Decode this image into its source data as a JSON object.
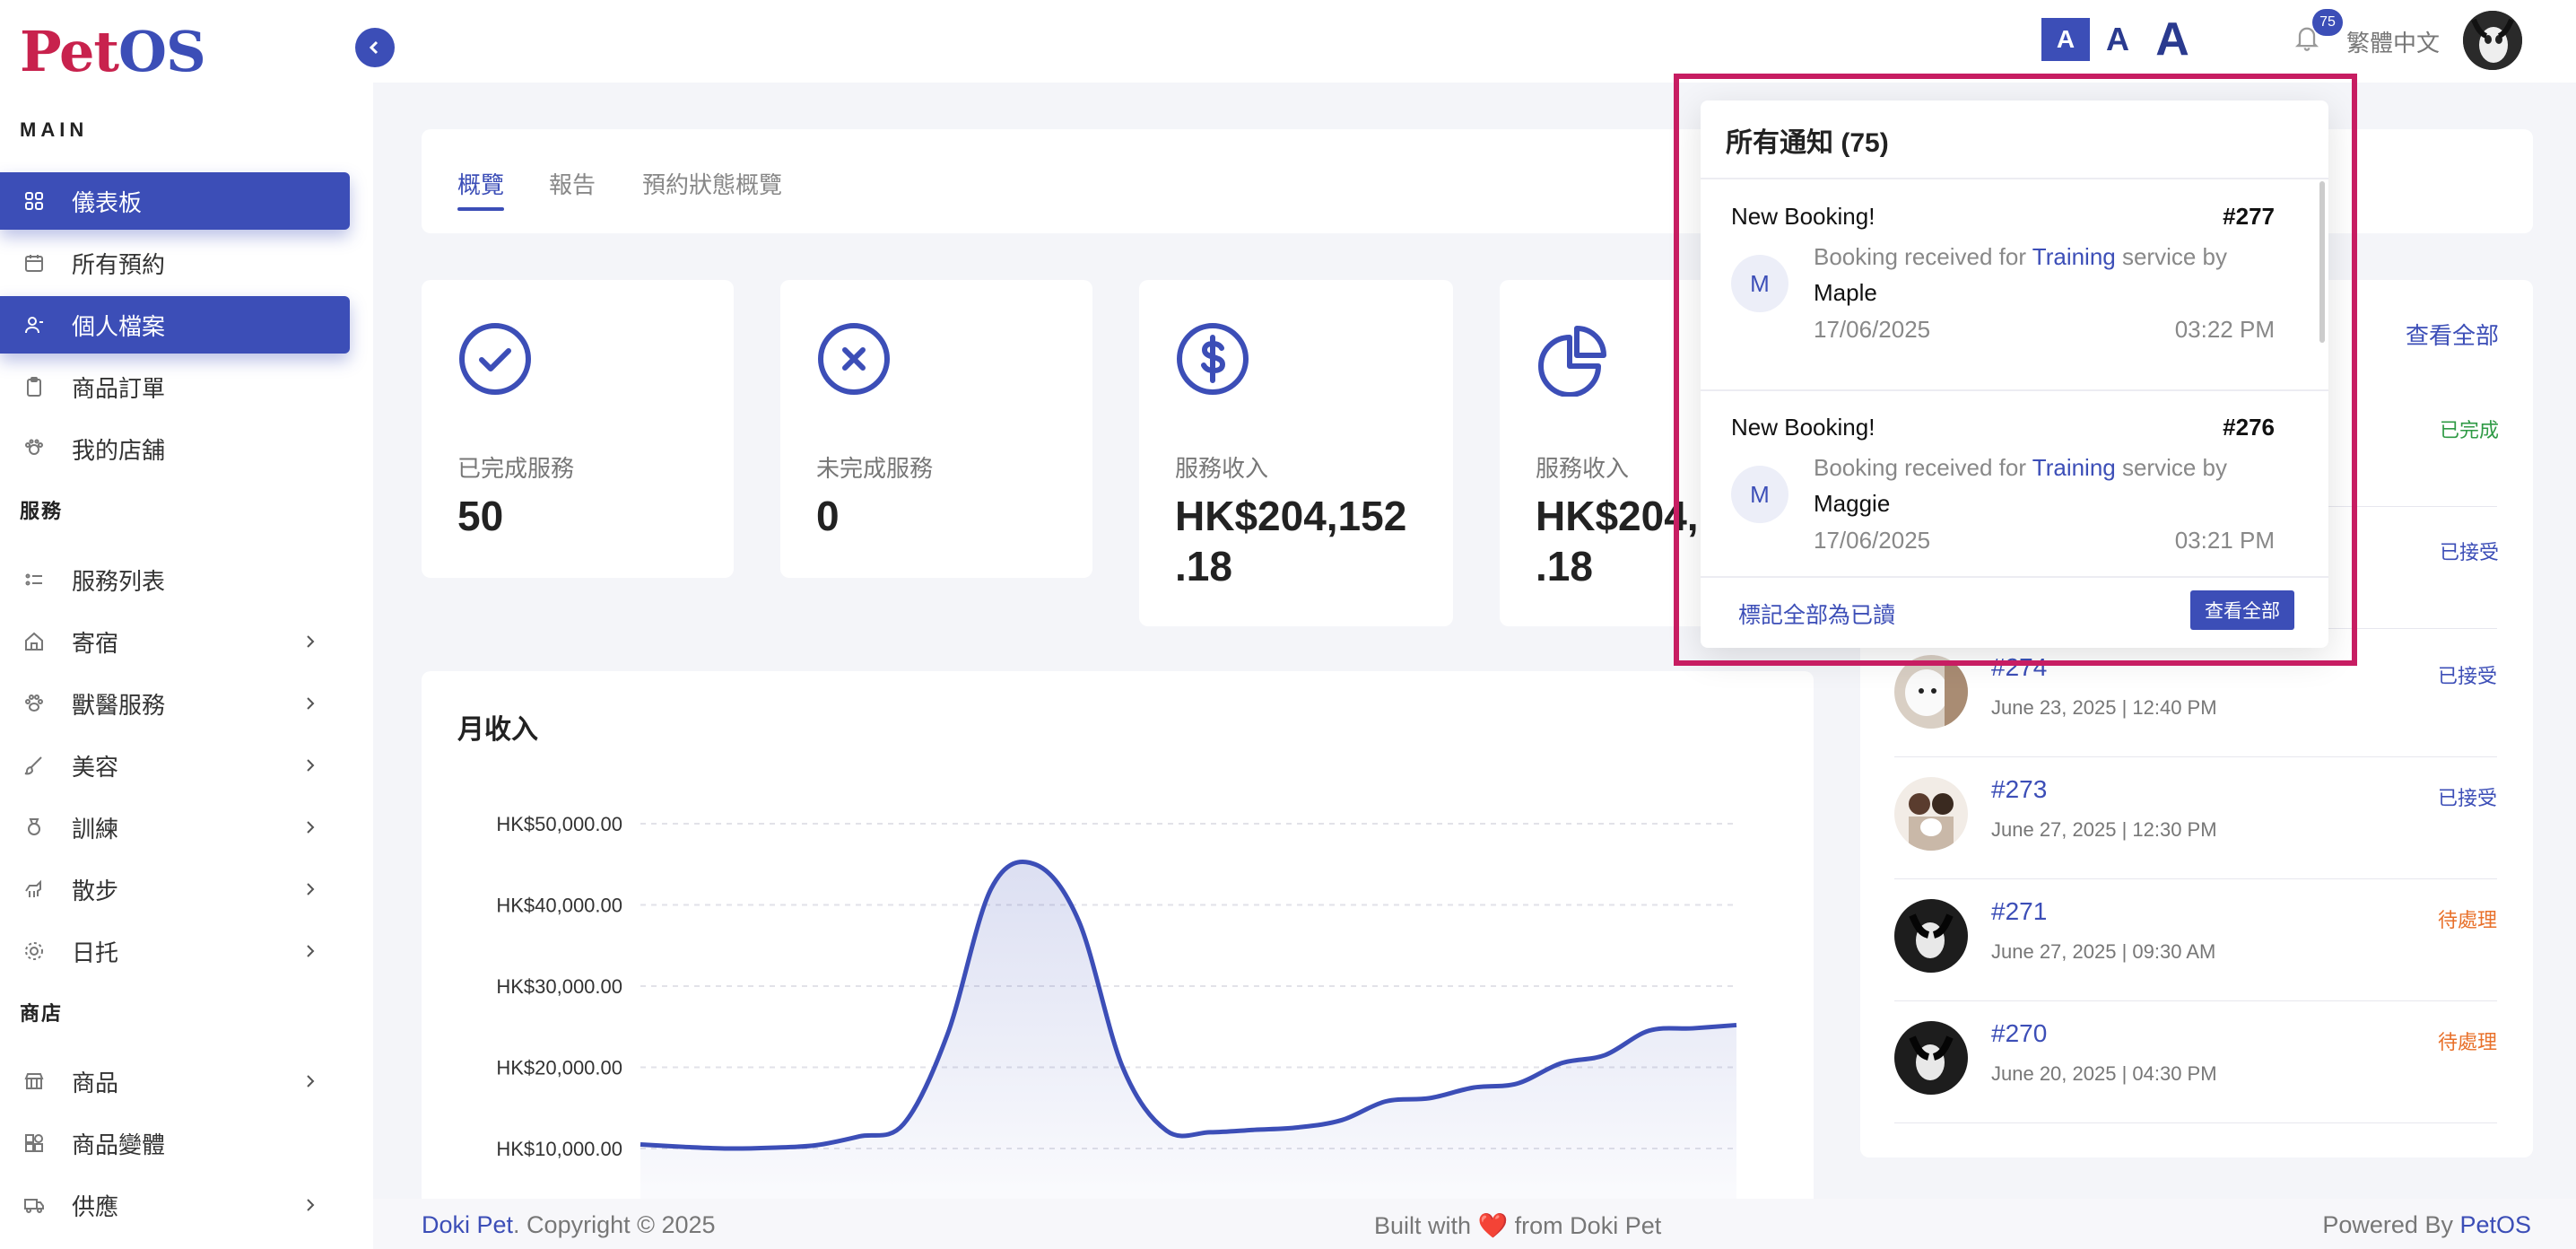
{
  "brand": {
    "logo_pet": "Pet",
    "logo_os": "OS"
  },
  "sidebar": {
    "sections": {
      "main": "MAIN",
      "services": "服務",
      "shop": "商店"
    },
    "items": [
      {
        "label": "儀表板",
        "icon": "dashboard-grid-icon"
      },
      {
        "label": "所有預約",
        "icon": "calendar-icon"
      },
      {
        "label": "個人檔案",
        "icon": "user-icon"
      },
      {
        "label": "商品訂單",
        "icon": "clipboard-icon"
      },
      {
        "label": "我的店舖",
        "icon": "store-icon"
      },
      {
        "label": "服務列表",
        "icon": "list-icon"
      },
      {
        "label": "寄宿",
        "icon": "home-icon"
      },
      {
        "label": "獸醫服務",
        "icon": "paw-icon"
      },
      {
        "label": "美容",
        "icon": "brush-icon"
      },
      {
        "label": "訓練",
        "icon": "medal-icon"
      },
      {
        "label": "散步",
        "icon": "dog-walk-icon"
      },
      {
        "label": "日托",
        "icon": "daycare-icon"
      },
      {
        "label": "商品",
        "icon": "shop-icon"
      },
      {
        "label": "商品變體",
        "icon": "variant-icon"
      },
      {
        "label": "供應",
        "icon": "truck-icon"
      }
    ]
  },
  "topbar": {
    "font_sizes": [
      "A",
      "A",
      "A"
    ],
    "notification_count": "75",
    "language": "繁體中文"
  },
  "tabs": [
    "概覽",
    "報告",
    "預約狀態概覽"
  ],
  "stats": [
    {
      "label": "已完成服務",
      "value": "50",
      "icon": "check-circle-icon"
    },
    {
      "label": "未完成服務",
      "value": "0",
      "icon": "x-circle-icon"
    },
    {
      "label": "服務收入",
      "value_line1": "HK$204,152",
      "value_line2": ".18",
      "icon": "dollar-circle-icon"
    },
    {
      "label": "服務收入",
      "value_line1": "HK$204,",
      "value_line2": ".18",
      "icon": "pie-chart-icon"
    }
  ],
  "chart_data": {
    "type": "area",
    "title": "月收入",
    "y_ticks": [
      "HK$50,000.00",
      "HK$40,000.00",
      "HK$30,000.00",
      "HK$20,000.00",
      "HK$10,000.00"
    ],
    "ylim": [
      0,
      50000
    ],
    "grid": true,
    "values": [
      10500,
      10200,
      10000,
      10100,
      10400,
      11500,
      13000,
      24000,
      42000,
      45000,
      38000,
      20000,
      12200,
      12000,
      12300,
      12600,
      13500,
      15800,
      16200,
      17500,
      18000,
      20500,
      21500,
      24500,
      24800,
      25200
    ],
    "color": "#3c4eb7"
  },
  "recent": {
    "view_all": "查看全部",
    "bookings": [
      {
        "id": "#274",
        "date": "June 23, 2025 | 12:40 PM",
        "status": "已接受",
        "status_color": "#3c4eb7"
      },
      {
        "id": "#273",
        "date": "June 27, 2025 | 12:30 PM",
        "status": "已接受",
        "status_color": "#3c4eb7"
      },
      {
        "id": "#271",
        "date": "June 27, 2025 | 09:30 AM",
        "status": "待處理",
        "status_color": "#e8702a"
      },
      {
        "id": "#270",
        "date": "June 20, 2025 | 04:30 PM",
        "status": "待處理",
        "status_color": "#e8702a"
      }
    ],
    "hidden_statuses": [
      {
        "status": "已完成",
        "status_color": "#2e9a44"
      },
      {
        "status": "已接受",
        "status_color": "#3c4eb7"
      }
    ]
  },
  "notifications": {
    "header": "所有通知 (75)",
    "items": [
      {
        "title": "New Booking!",
        "number": "#277",
        "avatar": "M",
        "msg_pre": "Booking received for ",
        "service": "Training",
        "msg_post": " service by",
        "who": "Maple",
        "date": "17/06/2025",
        "time": "03:22 PM"
      },
      {
        "title": "New Booking!",
        "number": "#276",
        "avatar": "M",
        "msg_pre": "Booking received for ",
        "service": "Training",
        "msg_post": " service by",
        "who": "Maggie",
        "date": "17/06/2025",
        "time": "03:21 PM"
      }
    ],
    "mark_all": "標記全部為已讀",
    "view_all": "查看全部"
  },
  "footer": {
    "brand_left": "Doki Pet",
    "copyright": ". Copyright © 2025",
    "built_pre": "Built with ",
    "heart": "❤️",
    "built_post": " from Doki Pet",
    "powered_pre": "Powered By ",
    "powered_brand": "PetOS"
  }
}
